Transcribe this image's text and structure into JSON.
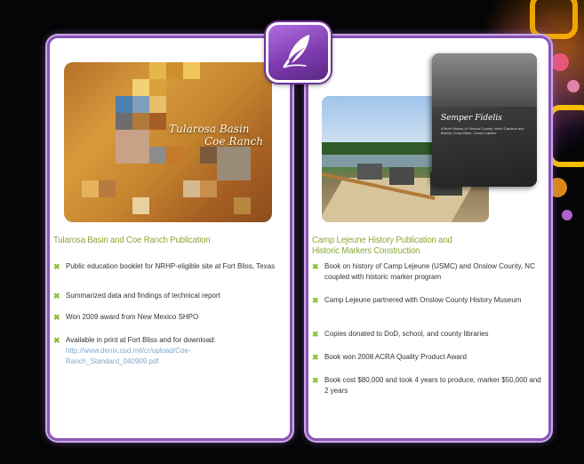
{
  "logo": {
    "icon": "quill-feather-icon"
  },
  "left_card": {
    "image_title_line1": "Tularosa Basin",
    "image_title_line2": "Coe Ranch",
    "title": "Tularosa Basin and Coe Ranch Publication",
    "bullets": [
      "Public education booklet for NRHP-eligible site at Fort Bliss, Texas",
      "Summarized data and findings of technical report",
      "Won 2009 award from New Mexico SHPO",
      "Available in print at Fort Bliss and for download:"
    ],
    "download_link": "http://www.denix.osd.mil/cr/upload/Coe-Ranch_Standard_040909.pdf"
  },
  "right_card": {
    "book_title": "Semper Fidelis",
    "book_subtitle": "A Brief History of Onslow County, North Carolina and Marine Corps Base, Camp Lejeune",
    "title_line1": "Camp Lejeune History Publication and",
    "title_line2": "Historic Markers Construction",
    "bullets": [
      "Book on history of Camp Lejeune (USMC) and Onslow County, NC coupled with historic marker program",
      "Camp Lejeune partnered with Onslow County History Museum",
      "Copies donated to DoD, school, and county libraries",
      "Book won 2008 ACRA Quality Product Award",
      "Book cost $80,000 and took 4 years to produce, marker $50,000 and 2 years"
    ]
  },
  "colors": {
    "panel_border": "#8a56b6",
    "title_green": "#8ba83a",
    "bullet_green": "#8bbf3a",
    "link_blue": "#7fa7c9",
    "logo_purple": "#7e3cb0"
  }
}
